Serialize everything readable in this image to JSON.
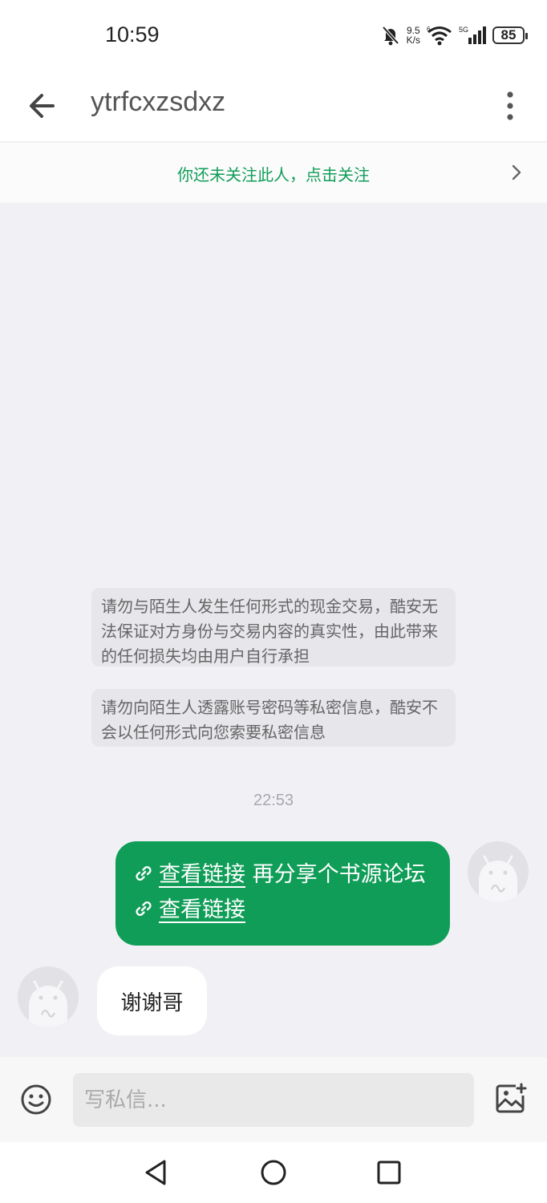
{
  "status_bar": {
    "time": "10:59",
    "net_speed_value": "9.5",
    "net_speed_unit": "K/s",
    "signal_label": "5G",
    "wifi_label": "6",
    "battery": "85"
  },
  "header": {
    "title": "ytrfcxzsdxz"
  },
  "follow_bar": {
    "text": "你还未关注此人，点击关注"
  },
  "notices": [
    "请勿与陌生人发生任何形式的现金交易，酷安无法保证对方身份与交易内容的真实性，由此带来的任何损失均由用户自行承担",
    "请勿向陌生人透露账号密码等私密信息，酷安不会以任何形式向您索要私密信息"
  ],
  "messages": {
    "time_label": "22:53",
    "outgoing": {
      "link1": "查看链接",
      "text": " 再分享个书源论坛 ",
      "link2": "查看链接"
    },
    "incoming": {
      "text": "谢谢哥"
    }
  },
  "composer": {
    "placeholder": "写私信..."
  },
  "colors": {
    "accent": "#109d58",
    "background": "#f0f0f5"
  }
}
